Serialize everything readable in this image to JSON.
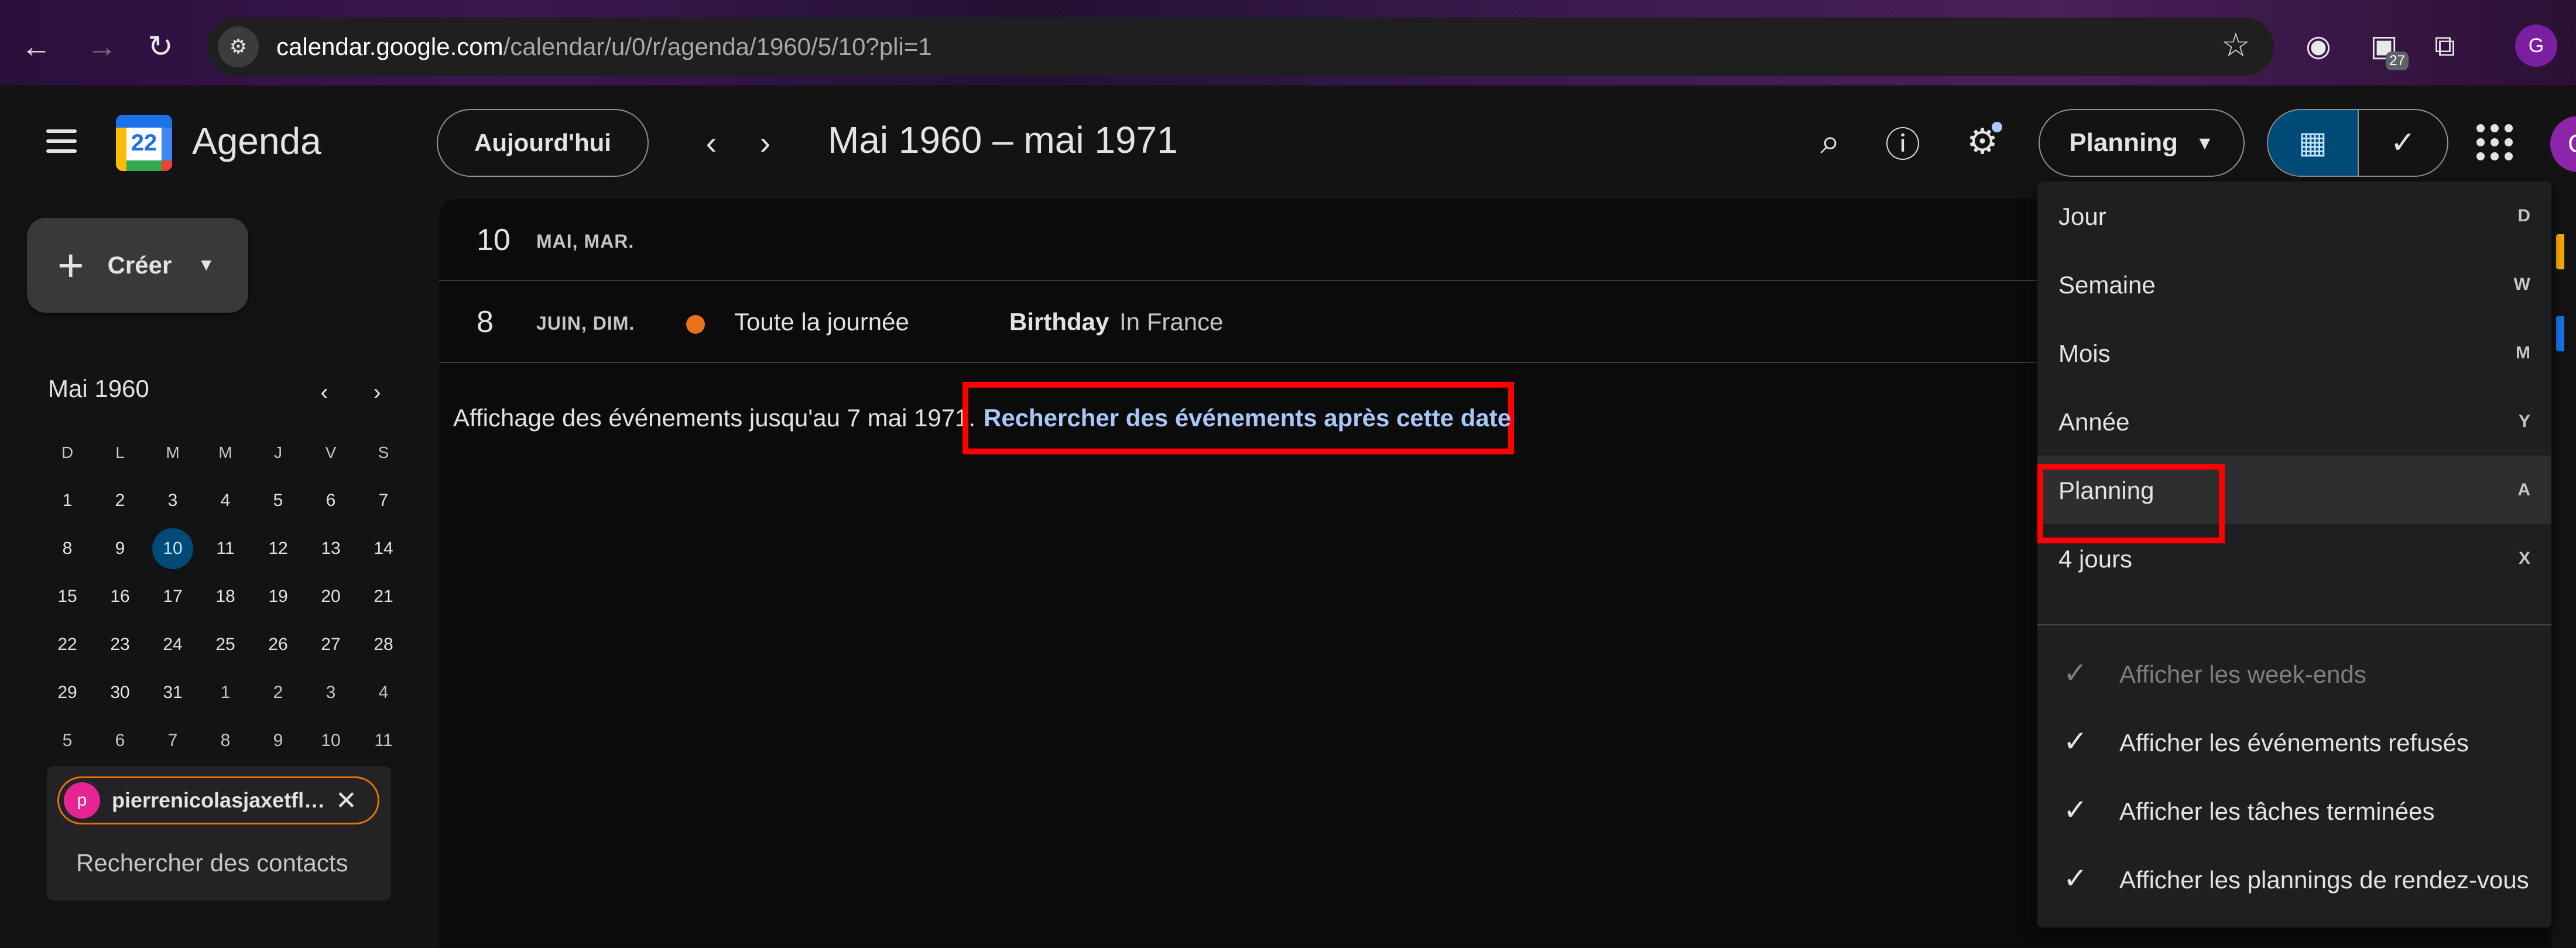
{
  "browser": {
    "url_domain": "calendar.google.com",
    "url_path": "/calendar/u/0/r/agenda/1960/5/10?pli=1",
    "extension_badge": "27",
    "profile_initial": "G"
  },
  "header": {
    "app_title": "Agenda",
    "logo_day": "22",
    "today_label": "Aujourd'hui",
    "date_range": "Mai 1960 – mai 1971",
    "view_label": "Planning",
    "account_initial": "G"
  },
  "sidebar": {
    "create_label": "Créer",
    "mini_cal": {
      "month_label": "Mai 1960",
      "dow": [
        "D",
        "L",
        "M",
        "M",
        "J",
        "V",
        "S"
      ],
      "weeks": [
        [
          "1",
          "2",
          "3",
          "4",
          "5",
          "6",
          "7"
        ],
        [
          "8",
          "9",
          "10",
          "11",
          "12",
          "13",
          "14"
        ],
        [
          "15",
          "16",
          "17",
          "18",
          "19",
          "20",
          "21"
        ],
        [
          "22",
          "23",
          "24",
          "25",
          "26",
          "27",
          "28"
        ],
        [
          "29",
          "30",
          "31",
          "1",
          "2",
          "3",
          "4"
        ],
        [
          "5",
          "6",
          "7",
          "8",
          "9",
          "10",
          "11"
        ]
      ],
      "selected_day": "10"
    },
    "contacts": {
      "chip_initial": "p",
      "chip_name": "pierrenicolasjaxetfleu...",
      "search_placeholder": "Rechercher des contacts"
    }
  },
  "agenda": {
    "rows": [
      {
        "day_num": "10",
        "day_label": "MAI, MAR."
      },
      {
        "day_num": "8",
        "day_label": "JUIN, DIM.",
        "event_time": "Toute la journée",
        "event_title": "Birthday",
        "event_location": "In France",
        "event_color": "#e8711a"
      }
    ],
    "showing_text": "Affichage des événements jusqu'au 7 mai 1971.",
    "search_after_link": "Rechercher des événements après cette date"
  },
  "view_menu": {
    "items": [
      {
        "label": "Jour",
        "key": "D"
      },
      {
        "label": "Semaine",
        "key": "W"
      },
      {
        "label": "Mois",
        "key": "M"
      },
      {
        "label": "Année",
        "key": "Y"
      },
      {
        "label": "Planning",
        "key": "A"
      },
      {
        "label": "4 jours",
        "key": "X"
      }
    ],
    "options": [
      {
        "label": "Afficher les week-ends",
        "checked": true,
        "disabled": true
      },
      {
        "label": "Afficher les événements refusés",
        "checked": true,
        "disabled": false
      },
      {
        "label": "Afficher les tâches terminées",
        "checked": true,
        "disabled": false
      },
      {
        "label": "Afficher les plannings de rendez-vous",
        "checked": true,
        "disabled": false
      }
    ]
  },
  "colors": {
    "accent_blue": "#a8c7fa",
    "selected_bg": "#004a77",
    "highlight_red": "#ff0000",
    "event_orange": "#e8711a",
    "contact_avatar": "#e52592"
  }
}
